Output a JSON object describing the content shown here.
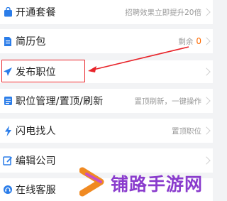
{
  "menu": {
    "items": [
      {
        "label": "开通套餐",
        "hint": "招聘效果立即提升20倍",
        "icon": "shopping-bag-icon"
      },
      {
        "label": "简历包",
        "hint": "剩余",
        "count": "0",
        "icon": "document-icon"
      },
      {
        "label": "发布职位",
        "hint": "",
        "icon": "paper-plane-icon"
      },
      {
        "label": "职位管理/置顶/刷新",
        "hint": "置顶刷新，一键操作",
        "icon": "list-icon"
      },
      {
        "label": "闪电找人",
        "hint": "置顶职位",
        "icon": "lightning-icon"
      },
      {
        "label": "编辑公司",
        "hint": "",
        "icon": "edit-icon"
      },
      {
        "label": "在线客服",
        "hint": "",
        "icon": "headset-icon"
      }
    ]
  },
  "watermark": {
    "text": "铺路手游网"
  },
  "colors": {
    "accent": "#2b7de9",
    "highlight": "#e8242a",
    "count": "#ff6a00",
    "watermark": "#8a3ccd"
  }
}
